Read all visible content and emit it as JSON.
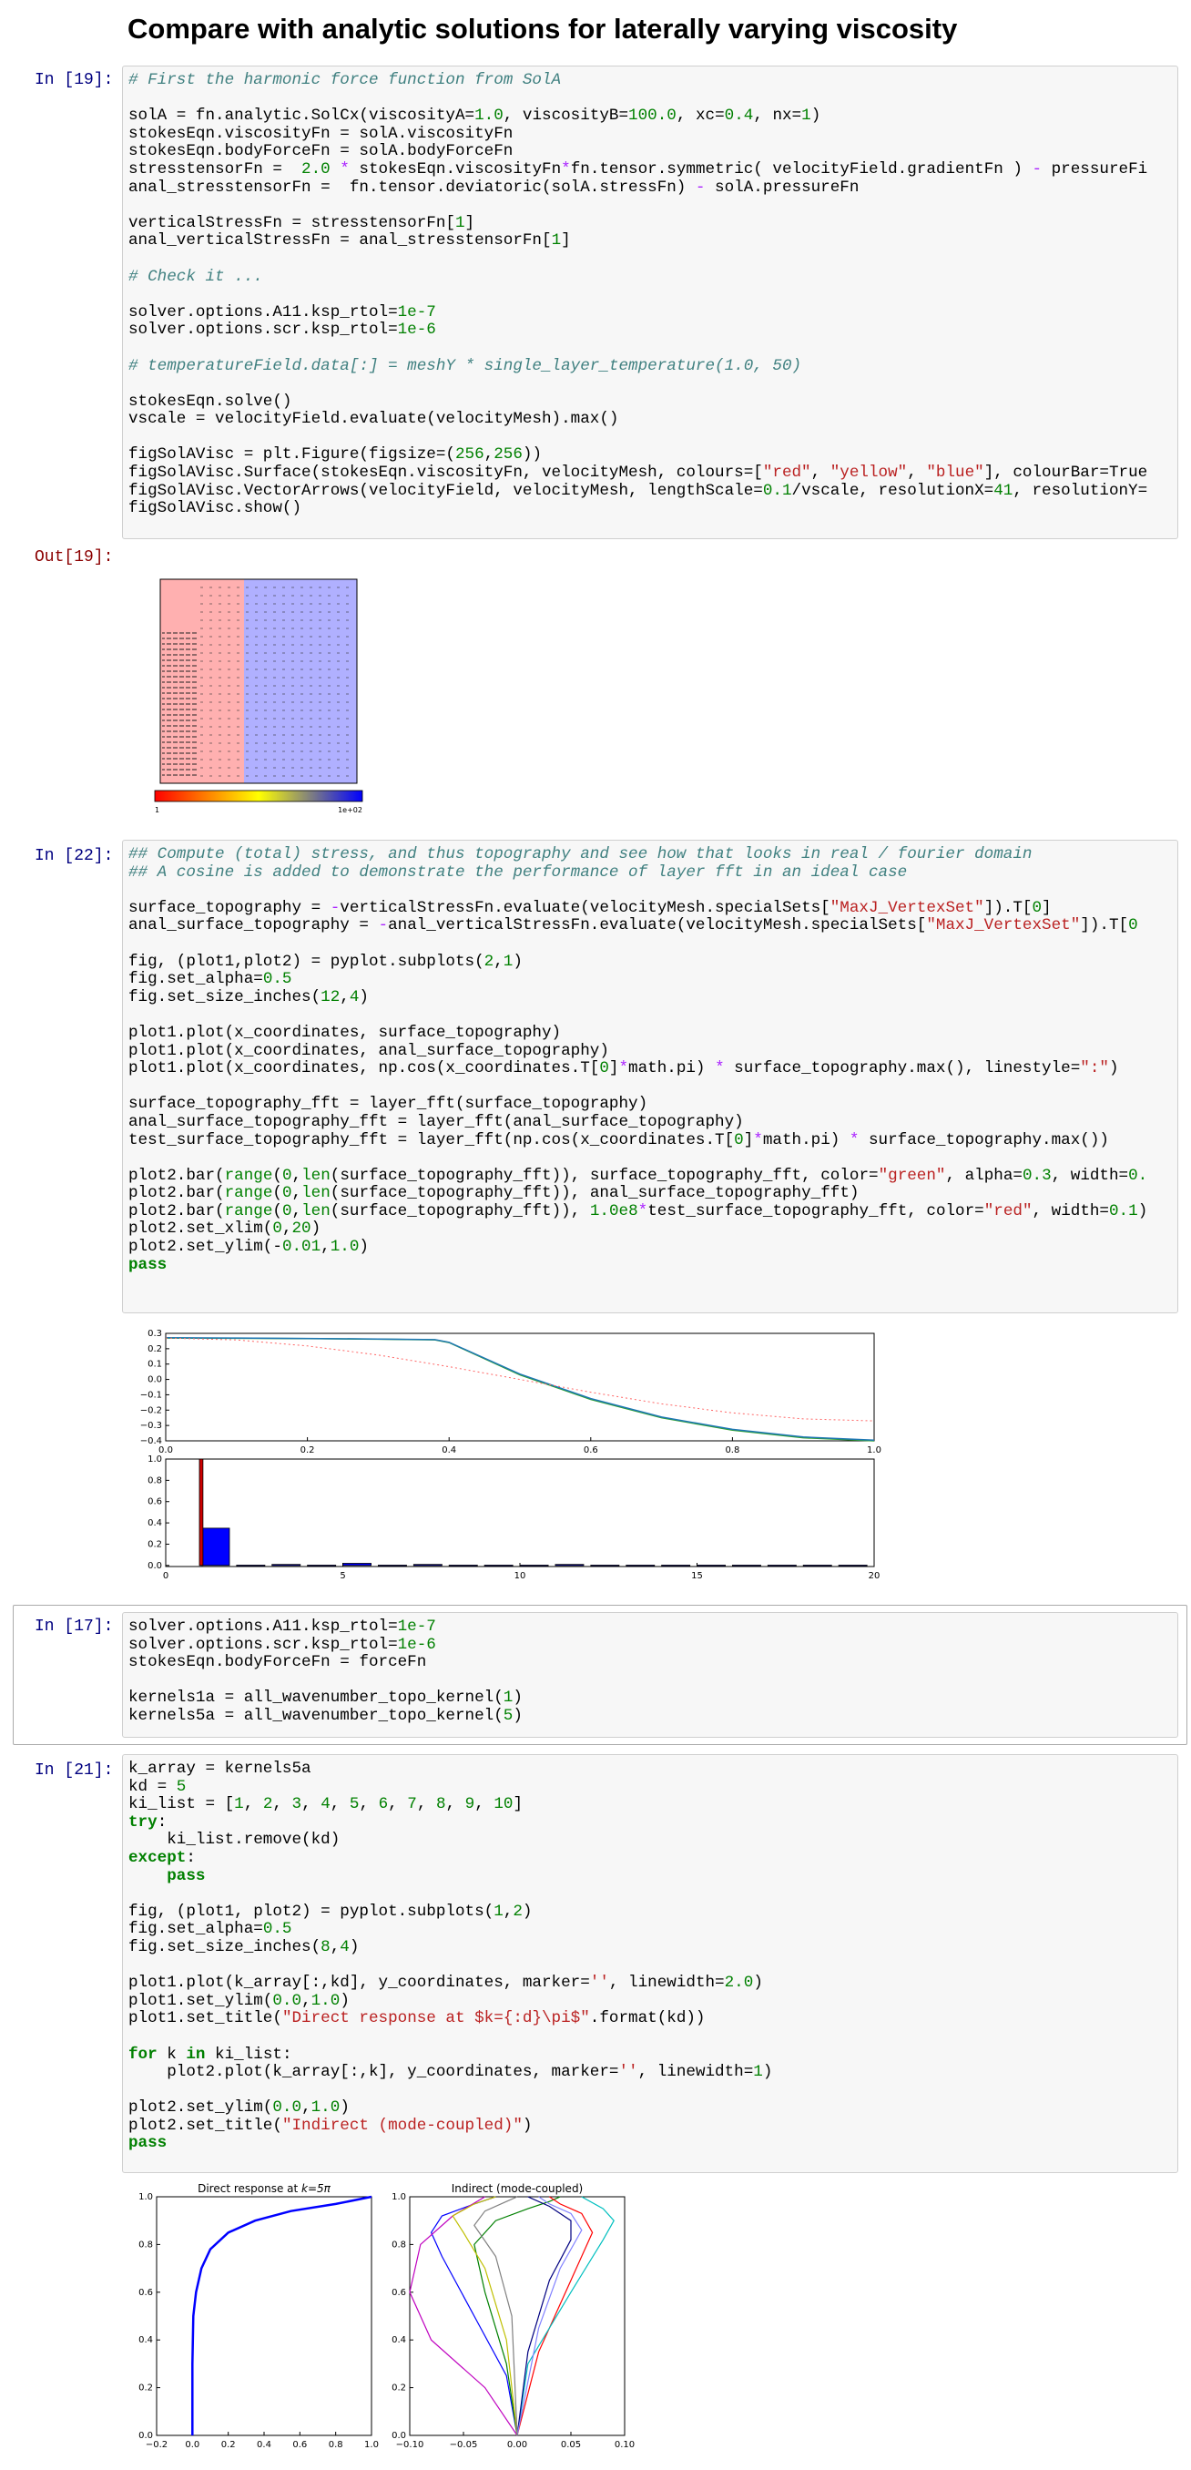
{
  "heading": "Compare with analytic solutions for laterally varying viscosity",
  "cells": {
    "c19": {
      "prompt": "In [19]:",
      "out_prompt": "Out[19]:",
      "lines": [
        "# First the harmonic force function from SolA",
        "",
        "solA = fn.analytic.SolCx(viscosityA=1.0, viscosityB=100.0, xc=0.4, nx=1)",
        "stokesEqn.viscosityFn = solA.viscosityFn",
        "stokesEqn.bodyForceFn = solA.bodyForceFn",
        "stresstensorFn =  2.0 * stokesEqn.viscosityFn*fn.tensor.symmetric( velocityField.gradientFn ) - pressureFi",
        "anal_stresstensorFn =  fn.tensor.deviatoric(solA.stressFn) - solA.pressureFn",
        "",
        "verticalStressFn = stresstensorFn[1]",
        "anal_verticalStressFn = anal_stresstensorFn[1]",
        "",
        "# Check it ...",
        "",
        "solver.options.A11.ksp_rtol=1e-7",
        "solver.options.scr.ksp_rtol=1e-6",
        "",
        "# temperatureField.data[:] = meshY * single_layer_temperature(1.0, 50)",
        "",
        "stokesEqn.solve()",
        "vscale = velocityField.evaluate(velocityMesh).max()",
        "",
        "figSolAVisc = plt.Figure(figsize=(256,256))",
        "figSolAVisc.Surface(stokesEqn.viscosityFn, velocityMesh, colours=[\"red\", \"yellow\", \"blue\"], colourBar=True",
        "figSolAVisc.VectorArrows(velocityField, velocityMesh, lengthScale=0.1/vscale, resolutionX=41, resolutionY=",
        "figSolAVisc.show()"
      ],
      "colourbar_min": "1",
      "colourbar_max": "1e+02"
    },
    "c22": {
      "prompt": "In [22]:",
      "lines": [
        "## Compute (total) stress, and thus topography and see how that looks in real / fourier domain",
        "## A cosine is added to demonstrate the performance of layer fft in an ideal case",
        "",
        "surface_topography = -verticalStressFn.evaluate(velocityMesh.specialSets[\"MaxJ_VertexSet\"]).T[0]",
        "anal_surface_topography = -anal_verticalStressFn.evaluate(velocityMesh.specialSets[\"MaxJ_VertexSet\"]).T[0",
        "",
        "fig, (plot1,plot2) = pyplot.subplots(2,1)",
        "fig.set_alpha=0.5",
        "fig.set_size_inches(12,4)",
        "",
        "plot1.plot(x_coordinates, surface_topography)",
        "plot1.plot(x_coordinates, anal_surface_topography)",
        "plot1.plot(x_coordinates, np.cos(x_coordinates.T[0]*math.pi) * surface_topography.max(), linestyle=\":\")",
        "",
        "surface_topography_fft = layer_fft(surface_topography)",
        "anal_surface_topography_fft = layer_fft(anal_surface_topography)",
        "test_surface_topography_fft = layer_fft(np.cos(x_coordinates.T[0]*math.pi) * surface_topography.max())",
        "",
        "plot2.bar(range(0,len(surface_topography_fft)), surface_topography_fft, color=\"green\", alpha=0.3, width=0.",
        "plot2.bar(range(0,len(surface_topography_fft)), anal_surface_topography_fft)",
        "plot2.bar(range(0,len(surface_topography_fft)), 1.0e8*test_surface_topography_fft, color=\"red\", width=0.1)",
        "plot2.set_xlim(0,20)",
        "plot2.set_ylim(-0.01,1.0)",
        "pass"
      ],
      "plot1_yticks": [
        "0.3",
        "0.2",
        "0.1",
        "0.0",
        "−0.1",
        "−0.2",
        "−0.3",
        "−0.4"
      ],
      "plot1_xticks": [
        "0.0",
        "0.2",
        "0.4",
        "0.6",
        "0.8",
        "1.0"
      ],
      "plot2_yticks": [
        "1.0",
        "0.8",
        "0.6",
        "0.4",
        "0.2",
        "0.0"
      ],
      "plot2_xticks": [
        "0",
        "5",
        "10",
        "15",
        "20"
      ]
    },
    "c17": {
      "prompt": "In [17]:",
      "lines": [
        "solver.options.A11.ksp_rtol=1e-7",
        "solver.options.scr.ksp_rtol=1e-6",
        "stokesEqn.bodyForceFn = forceFn",
        "",
        "kernels1a = all_wavenumber_topo_kernel(1)",
        "kernels5a = all_wavenumber_topo_kernel(5)"
      ]
    },
    "c21": {
      "prompt": "In [21]:",
      "lines": [
        "k_array = kernels5a",
        "kd = 5",
        "ki_list = [1, 2, 3, 4, 5, 6, 7, 8, 9, 10]",
        "try:",
        "    ki_list.remove(kd)",
        "except:",
        "    pass",
        "",
        "fig, (plot1, plot2) = pyplot.subplots(1,2)",
        "fig.set_alpha=0.5",
        "fig.set_size_inches(8,4)",
        "",
        "plot1.plot(k_array[:,kd], y_coordinates, marker='', linewidth=2.0)",
        "plot1.set_ylim(0.0,1.0)",
        "plot1.set_title(\"Direct response at $k={:d}\\pi$\".format(kd))",
        "",
        "for k in ki_list:",
        "    plot2.plot(k_array[:,k], y_coordinates, marker='', linewidth=1)",
        "",
        "plot2.set_ylim(0.0,1.0)",
        "plot2.set_title(\"Indirect (mode-coupled)\")",
        "pass"
      ],
      "left_title": "Direct response at ",
      "left_title_math": "k=5π",
      "right_title": "Indirect (mode-coupled)",
      "left_yticks": [
        "1.0",
        "0.8",
        "0.6",
        "0.4",
        "0.2",
        "0.0"
      ],
      "left_xticks": [
        "−0.2",
        "0.0",
        "0.2",
        "0.4",
        "0.6",
        "0.8",
        "1.0"
      ],
      "right_xticks": [
        "−0.10",
        "−0.05",
        "0.00",
        "0.05",
        "0.10"
      ]
    }
  },
  "chart_data": [
    {
      "type": "line",
      "xlim": [
        0.0,
        1.0
      ],
      "ylim": [
        -0.4,
        0.3
      ],
      "series": [
        {
          "color": "#2ca02c",
          "x": [
            0.0,
            0.1,
            0.2,
            0.3,
            0.38,
            0.4,
            0.5,
            0.6,
            0.7,
            0.8,
            0.9,
            1.0
          ],
          "y": [
            0.27,
            0.268,
            0.266,
            0.262,
            0.258,
            0.24,
            0.03,
            -0.13,
            -0.25,
            -0.33,
            -0.38,
            -0.4
          ]
        },
        {
          "color": "#1f77b4",
          "x": [
            0.0,
            0.1,
            0.2,
            0.3,
            0.38,
            0.4,
            0.5,
            0.6,
            0.7,
            0.8,
            0.9,
            1.0
          ],
          "y": [
            0.272,
            0.27,
            0.267,
            0.263,
            0.259,
            0.242,
            0.035,
            -0.125,
            -0.245,
            -0.325,
            -0.375,
            -0.395
          ]
        },
        {
          "color": "#ff6666",
          "dashed": true,
          "x": [
            0.0,
            0.1,
            0.2,
            0.3,
            0.4,
            0.5,
            0.6,
            0.7,
            0.8,
            0.9,
            1.0
          ],
          "y": [
            0.27,
            0.257,
            0.218,
            0.159,
            0.083,
            0.0,
            -0.083,
            -0.159,
            -0.218,
            -0.257,
            -0.27
          ]
        }
      ]
    },
    {
      "type": "bar",
      "xlim": [
        0,
        20
      ],
      "ylim": [
        -0.01,
        1.0
      ],
      "series": [
        {
          "color": "#0000ff",
          "x": [
            1,
            2,
            3,
            4,
            5,
            6,
            7,
            8,
            9,
            10,
            11,
            12,
            13,
            14,
            15,
            16,
            17,
            18,
            19
          ],
          "values": [
            0.35,
            0.0,
            0.01,
            0.0,
            0.02,
            0.0,
            0.01,
            0.0,
            0.0,
            0.0,
            0.01,
            0.0,
            0.0,
            0.0,
            0.0,
            0.0,
            0.0,
            0.0,
            0.0
          ],
          "width": 0.8
        },
        {
          "color": "#cc0000",
          "x": [
            1
          ],
          "values": [
            1.0
          ],
          "width": 0.1
        }
      ]
    },
    {
      "type": "line",
      "title": "Direct response at k=5π",
      "xlim": [
        -0.2,
        1.0
      ],
      "ylim": [
        0.0,
        1.0
      ],
      "series": [
        {
          "color": "#0000ff",
          "x": [
            0.0,
            0.0,
            0.005,
            0.02,
            0.05,
            0.1,
            0.2,
            0.35,
            0.55,
            0.8,
            1.0
          ],
          "y": [
            0.0,
            0.3,
            0.5,
            0.6,
            0.7,
            0.78,
            0.85,
            0.9,
            0.94,
            0.97,
            1.0
          ]
        }
      ]
    },
    {
      "type": "line",
      "title": "Indirect (mode-coupled)",
      "xlim": [
        -0.1,
        0.1
      ],
      "ylim": [
        0.0,
        1.0
      ],
      "series": [
        {
          "color": "#0000ff",
          "x": [
            0.0,
            -0.01,
            -0.04,
            -0.07,
            -0.08,
            -0.07,
            -0.04,
            -0.02
          ],
          "y": [
            0.0,
            0.25,
            0.5,
            0.75,
            0.85,
            0.92,
            0.97,
            1.0
          ]
        },
        {
          "color": "#008000",
          "x": [
            0.0,
            -0.01,
            -0.03,
            -0.04,
            -0.02,
            0.01,
            0.03,
            0.04
          ],
          "y": [
            0.0,
            0.3,
            0.6,
            0.8,
            0.9,
            0.95,
            0.98,
            1.0
          ]
        },
        {
          "color": "#ff0000",
          "x": [
            0.0,
            0.02,
            0.05,
            0.07,
            0.06,
            0.04,
            0.03
          ],
          "y": [
            0.0,
            0.35,
            0.65,
            0.85,
            0.93,
            0.97,
            1.0
          ]
        },
        {
          "color": "#00bfbf",
          "x": [
            0.0,
            0.01,
            0.05,
            0.08,
            0.09,
            0.08,
            0.06
          ],
          "y": [
            0.0,
            0.3,
            0.6,
            0.82,
            0.9,
            0.95,
            1.0
          ]
        },
        {
          "color": "#bf00bf",
          "x": [
            0.0,
            -0.03,
            -0.08,
            -0.1,
            -0.09,
            -0.06,
            -0.03
          ],
          "y": [
            0.0,
            0.2,
            0.4,
            0.6,
            0.8,
            0.92,
            1.0
          ]
        },
        {
          "color": "#bfbf00",
          "x": [
            0.0,
            -0.01,
            -0.03,
            -0.05,
            -0.06,
            -0.04,
            -0.02
          ],
          "y": [
            0.0,
            0.4,
            0.7,
            0.85,
            0.92,
            0.97,
            1.0
          ]
        },
        {
          "color": "#000080",
          "x": [
            0.0,
            0.01,
            0.03,
            0.05,
            0.05,
            0.03,
            0.01
          ],
          "y": [
            0.0,
            0.35,
            0.65,
            0.82,
            0.9,
            0.96,
            1.0
          ]
        },
        {
          "color": "#8080ff",
          "x": [
            0.0,
            0.02,
            0.04,
            0.06,
            0.05,
            0.03,
            0.02
          ],
          "y": [
            0.0,
            0.45,
            0.7,
            0.86,
            0.93,
            0.97,
            1.0
          ]
        },
        {
          "color": "#808080",
          "x": [
            0.0,
            -0.005,
            -0.02,
            -0.04,
            -0.03,
            -0.01,
            0.0
          ],
          "y": [
            0.0,
            0.5,
            0.75,
            0.88,
            0.94,
            0.98,
            1.0
          ]
        }
      ]
    }
  ]
}
